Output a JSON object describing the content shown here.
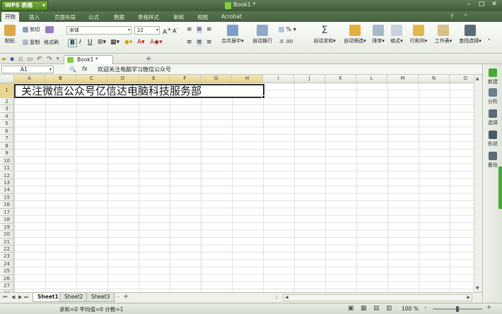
{
  "app": {
    "name": "WPS 表格",
    "doc_title": "Book1 *"
  },
  "menus": [
    "开始",
    "插入",
    "页面布局",
    "公式",
    "数据",
    "表格样式",
    "审阅",
    "视图",
    "Acrobat"
  ],
  "ribbon": {
    "paste": "粘贴",
    "cut": "剪切",
    "copy": "复制",
    "format_painter": "格式刷",
    "font_name": "宋体",
    "font_size": "22",
    "merge_center": "合并居中",
    "wrap_text": "自动换行",
    "percent": "%",
    "autosum": "自动求和",
    "autofilter": "自动筛选",
    "sort": "排序",
    "format": "格式",
    "row_col": "行和列",
    "worksheet": "工作表",
    "find_select": "查找选择"
  },
  "tab": {
    "label": "Book1 *"
  },
  "formula_bar": {
    "cell_ref": "A1",
    "fx": "fx",
    "content": "欢迎关注电脑学习微信公众号"
  },
  "columns": [
    "A",
    "B",
    "C",
    "D",
    "E",
    "F",
    "G",
    "H",
    "I",
    "J",
    "K",
    "L",
    "M",
    "N",
    "O"
  ],
  "rows": [
    "1",
    "2",
    "3",
    "4",
    "5",
    "6",
    "7",
    "8",
    "9",
    "10",
    "11",
    "12",
    "13",
    "14",
    "15",
    "16",
    "17",
    "18",
    "19",
    "20",
    "21",
    "22",
    "23",
    "24",
    "25",
    "26",
    "27",
    "28"
  ],
  "cell_a1": "关注微信公众号亿信达电脑科技服务部",
  "side_panel": [
    "新建",
    "分析",
    "选择",
    "形状",
    "备份"
  ],
  "sheets": [
    "Sheet1",
    "Sheet2",
    "Sheet3"
  ],
  "status": {
    "summary": "求和=0  平均值=0  计数=1",
    "zoom": "100 %"
  }
}
